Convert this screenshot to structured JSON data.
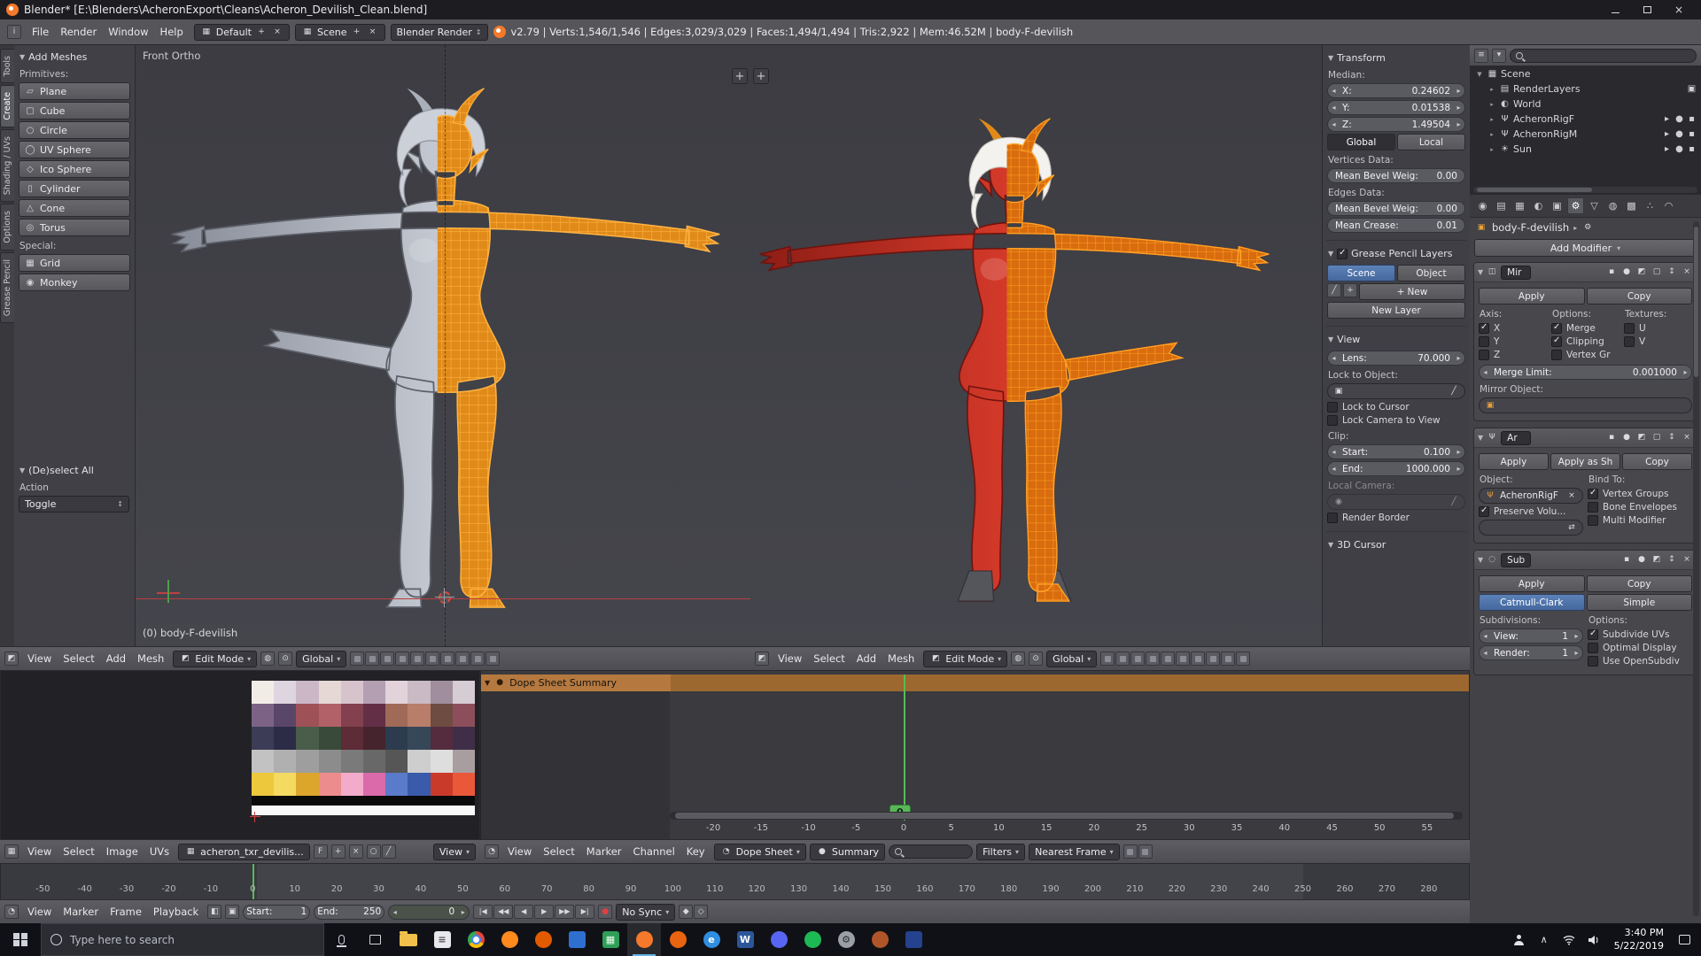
{
  "colors": {
    "accent-blue": "#4a70a8",
    "accent-orange": "#e8821e",
    "selected-channel": "#b5793f",
    "frame-green": "#57bb57",
    "wire-orange": "#ffa428"
  },
  "window": {
    "title": "Blender* [E:\\Blenders\\AcheronExport\\Cleans\\Acheron_Devilish_Clean.blend]"
  },
  "info_bar": {
    "menus": [
      "File",
      "Render",
      "Window",
      "Help"
    ],
    "layout_name": "Default",
    "scene_name": "Scene",
    "engine": "Blender Render",
    "stats": "v2.79 | Verts:1,546/1,546 | Edges:3,029/3,029 | Faces:1,494/1,494 | Tris:2,922 | Mem:46.52M | body-F-devilish"
  },
  "tool_tabs": [
    {
      "label": "Tools",
      "active": false
    },
    {
      "label": "Create",
      "active": true
    },
    {
      "label": "Shading / UVs",
      "active": false
    },
    {
      "label": "Options",
      "active": false
    },
    {
      "label": "Grease Pencil",
      "active": false
    }
  ],
  "tool_shelf": {
    "add_meshes_title": "Add Meshes",
    "primitives_label": "Primitives:",
    "primitives": [
      "Plane",
      "Cube",
      "Circle",
      "UV Sphere",
      "Ico Sphere",
      "Cylinder",
      "Cone",
      "Torus"
    ],
    "special_label": "Special:",
    "special": [
      "Grid",
      "Monkey"
    ],
    "deselect_title": "(De)select All",
    "action_label": "Action",
    "action_value": "Toggle"
  },
  "viewport": {
    "left_label": "Front Ortho",
    "left_object": "(0) body-F-devilish",
    "menus": [
      "View",
      "Select",
      "Add",
      "Mesh"
    ],
    "mode": "Edit Mode",
    "orientation": "Global",
    "header_icons": [
      "manipulator-translate",
      "manipulator-rotate",
      "manipulator-scale",
      "manipulator-axes",
      "snap-magnet",
      "snap-element",
      "snap-target",
      "proportional-editing",
      "opengl-render",
      "opengl-render-anim"
    ]
  },
  "n_panel": {
    "transform_title": "Transform",
    "median_label": "Median:",
    "x_label": "X:",
    "x": "0.24602",
    "y_label": "Y:",
    "y": "0.01538",
    "z_label": "Z:",
    "z": "1.49504",
    "global": "Global",
    "local": "Local",
    "vertices_label": "Vertices Data:",
    "bevel_label": "Mean Bevel Weig:",
    "bevel_value": "0.00",
    "edges_label": "Edges Data:",
    "crease_label": "Mean Crease:",
    "crease_value": "0.01",
    "gp_title": "Grease Pencil Layers",
    "gp_scene": "Scene",
    "gp_object": "Object",
    "gp_new": "New",
    "gp_new_layer": "New Layer",
    "view_title": "View",
    "lens_label": "Lens:",
    "lens": "70.000",
    "lock_object_label": "Lock to Object:",
    "lock_cursor": "Lock to Cursor",
    "lock_camera": "Lock Camera to View",
    "clip_label": "Clip:",
    "clip_start_label": "Start:",
    "clip_start": "0.100",
    "clip_end_label": "End:",
    "clip_end": "1000.000",
    "local_camera_label": "Local Camera:",
    "render_border": "Render Border",
    "cursor_title": "3D Cursor"
  },
  "outliner": {
    "items": [
      {
        "label": "Scene",
        "icon": "scene",
        "depth": 0,
        "right": []
      },
      {
        "label": "RenderLayers",
        "icon": "render-layers",
        "depth": 1,
        "right": [
          "render-layer-toggle"
        ]
      },
      {
        "label": "World",
        "icon": "world",
        "depth": 1,
        "right": []
      },
      {
        "label": "AcheronRigF",
        "icon": "armature",
        "depth": 1,
        "right": [
          "restrict-select",
          "restrict-view",
          "restrict-render"
        ]
      },
      {
        "label": "AcheronRigM",
        "icon": "armature",
        "depth": 1,
        "right": [
          "restrict-select",
          "restrict-view",
          "restrict-render"
        ]
      },
      {
        "label": "Sun",
        "icon": "lamp",
        "depth": 1,
        "right": [
          "restrict-select",
          "restrict-view",
          "restrict-render"
        ]
      }
    ]
  },
  "properties": {
    "tabs": [
      "render",
      "render-layers",
      "scene",
      "world",
      "object",
      "modifiers",
      "object-data",
      "material",
      "texture",
      "particles",
      "physics"
    ],
    "active_tab": "modifiers",
    "context_object": "body-F-devilish",
    "add_modifier_label": "Add Modifier",
    "modifiers": {
      "mirror": {
        "name": "Mir",
        "apply": "Apply",
        "copy": "Copy",
        "axis_label": "Axis:",
        "axis_x": "X",
        "axis_y": "Y",
        "axis_z": "Z",
        "options_label": "Options:",
        "merge": "Merge",
        "clipping": "Clipping",
        "vertex_gr": "Vertex Gr",
        "textures_label": "Textures:",
        "u": "U",
        "v": "V",
        "merge_limit_label": "Merge Limit:",
        "merge_limit": "0.001000",
        "mirror_object_label": "Mirror Object:"
      },
      "armature": {
        "name": "Ar",
        "apply": "Apply",
        "apply_as_shape": "Apply as Sh",
        "copy": "Copy",
        "object_label": "Object:",
        "object": "AcheronRigF",
        "bind_label": "Bind To:",
        "vertex_groups": "Vertex Groups",
        "bone_envelopes": "Bone Envelopes",
        "preserve_volume": "Preserve Volu...",
        "multi_modifier": "Multi Modifier"
      },
      "subsurf": {
        "name": "Sub",
        "apply": "Apply",
        "copy": "Copy",
        "catmull_clark": "Catmull-Clark",
        "simple": "Simple",
        "subdivisions_label": "Subdivisions:",
        "view_label": "View:",
        "view": "1",
        "render_label": "Render:",
        "render": "1",
        "options_label": "Options:",
        "subdivide_uvs": "Subdivide UVs",
        "optimal_display": "Optimal Display",
        "use_opensubdiv": "Use OpenSubdiv"
      }
    }
  },
  "uv_editor": {
    "menus": [
      "View",
      "Select",
      "Image",
      "UVs"
    ],
    "image_name": "acheron_txr_devilis...",
    "fake_user": "F",
    "mode": "View",
    "header_icons": [
      "pin",
      "paint-brush"
    ],
    "palette": [
      [
        "#f2ece6",
        "#ddd5e0",
        "#cbb7c6",
        "#e6d8d4",
        "#d7c3cc",
        "#b49fb2",
        "#e2d2da",
        "#c9bac4",
        "#a08e9e",
        "#d5ccd4"
      ],
      [
        "#7c6386",
        "#5a4668",
        "#9e5258",
        "#b26168",
        "#83404e",
        "#622f46",
        "#a06a58",
        "#b87e6a",
        "#6e4c42",
        "#8c4e5a"
      ],
      [
        "#3c3c56",
        "#2c2c46",
        "#4a5c4a",
        "#3a4a3a",
        "#5e2c36",
        "#46242e",
        "#2c3c4e",
        "#364858",
        "#542c3e",
        "#402e48"
      ],
      [
        "#c2c2c2",
        "#b0b0b0",
        "#9e9e9e",
        "#8c8c8c",
        "#7a7a7a",
        "#686868",
        "#565656",
        "#cecece",
        "#dedede",
        "#a89ea0"
      ],
      [
        "#eec83c",
        "#f4da60",
        "#dca62c",
        "#ec8c8c",
        "#f2abcb",
        "#da6aaa",
        "#5a7aca",
        "#3a5aaa",
        "#ca3a2a",
        "#ea583a"
      ],
      [
        "#0a0a0a"
      ],
      [
        "#f8f8f8"
      ]
    ]
  },
  "dope_sheet": {
    "menus": [
      "View",
      "Select",
      "Marker",
      "Channel",
      "Key"
    ],
    "mode": "Dope Sheet",
    "summary_label": "Summary",
    "filters_label": "Filters",
    "snap_value": "Nearest Frame",
    "channel_label": "Dope Sheet Summary",
    "current_frame": "0",
    "header_icons": [
      "copy-keyframes",
      "paste-keyframes"
    ],
    "ruler": [
      -20,
      -15,
      -10,
      -5,
      0,
      5,
      10,
      15,
      20,
      25,
      30,
      35,
      40,
      45,
      50,
      55
    ]
  },
  "timeline": {
    "menus": [
      "View",
      "Marker",
      "Frame",
      "Playback"
    ],
    "start_label": "Start:",
    "start": "1",
    "end_label": "End:",
    "end": "250",
    "frame": "0",
    "sync": "No Sync",
    "transport": [
      {
        "name": "jump-to-start",
        "glyph": "|◀"
      },
      {
        "name": "prev-keyframe",
        "glyph": "◀◀"
      },
      {
        "name": "play-reverse",
        "glyph": "◀"
      },
      {
        "name": "play",
        "glyph": "▶"
      },
      {
        "name": "next-keyframe",
        "glyph": "▶▶"
      },
      {
        "name": "jump-to-end",
        "glyph": "▶|"
      }
    ],
    "trailing_icons": [
      "autokey",
      "keying-set"
    ],
    "ruler": [
      -50,
      -40,
      -30,
      -20,
      -10,
      0,
      10,
      20,
      30,
      40,
      50,
      60,
      70,
      80,
      90,
      100,
      110,
      120,
      130,
      140,
      150,
      160,
      170,
      180,
      190,
      200,
      210,
      220,
      230,
      240,
      250,
      260,
      270,
      280
    ]
  },
  "taskbar": {
    "search_placeholder": "Type here to search",
    "time": "3:40 PM",
    "date": "5/22/2019",
    "apps": [
      {
        "name": "file-explorer",
        "shape": "folder",
        "bg": "#f0c04a"
      },
      {
        "name": "app-notepad",
        "shape": "square",
        "bg": "#e8e8ec",
        "glyph": "≡",
        "fg": "#555"
      },
      {
        "name": "app-chrome",
        "shape": "circle",
        "bg": "chrome"
      },
      {
        "name": "app-firefox",
        "shape": "circle",
        "bg": "#ff8a1e"
      },
      {
        "name": "app-vlc",
        "shape": "circle",
        "bg": "#e35b00"
      },
      {
        "name": "app-photos",
        "shape": "square",
        "bg": "#2e6fd0"
      },
      {
        "name": "app-sheets",
        "shape": "square",
        "bg": "#2f9e57",
        "glyph": "▦",
        "fg": "#eaffee"
      },
      {
        "name": "app-blender",
        "shape": "circle",
        "bg": "#f5792a",
        "active": true
      },
      {
        "name": "app-firefox-dev",
        "shape": "circle",
        "bg": "#e86410"
      },
      {
        "name": "app-edge",
        "shape": "circle",
        "bg": "#2f8ee0",
        "glyph": "e"
      },
      {
        "name": "app-word",
        "shape": "square",
        "bg": "#2b579a",
        "glyph": "W"
      },
      {
        "name": "app-discord",
        "shape": "circle",
        "bg": "#5865f2"
      },
      {
        "name": "app-spotify",
        "shape": "circle",
        "bg": "#1db954"
      },
      {
        "name": "app-settings",
        "shape": "circle",
        "bg": "#9aa0a6",
        "glyph": "⚙",
        "fg": "#2e2e2e"
      },
      {
        "name": "app-gimp",
        "shape": "circle",
        "bg": "#b0552a"
      },
      {
        "name": "app-movies",
        "shape": "square",
        "bg": "#24428e"
      }
    ]
  },
  "models": {
    "left": {
      "skin": "#c6cad3",
      "skin_dark": "#878c98",
      "outline": "#5c6068",
      "hair": "#ccd0d8",
      "hair_edge": "#8e939e",
      "horn": "#aab0ba",
      "wire_base": "#e08a1a",
      "wire": "#ffb340",
      "tail": "left"
    },
    "right": {
      "skin": "#d63a2a",
      "skin_dark": "#8e1d16",
      "outline": "#6e130e",
      "hair": "#f4f2ee",
      "hair_edge": "#c2beb8",
      "horn": "#e08a1a",
      "hoof": "#55555c",
      "wire_base": "#d96c0e",
      "wire": "#ffa428",
      "tail": "right"
    }
  },
  "glyphs": {
    "panel-open": "▼",
    "panel-closed": "▸",
    "dropdown": "▾",
    "arrow-left": "◂",
    "arrow-right": "▸",
    "check": "✓",
    "close": "×",
    "plus": "+",
    "updown": "↕",
    "swap": "⇄",
    "editor-3d-view": "◩",
    "editor-image": "▦",
    "editor-dope-sheet": "◔",
    "editor-timeline": "◔",
    "editor-outliner": "≡",
    "editor-properties": "▤",
    "editor-info": "i",
    "edit-mode": "◩",
    "viewport-shading": "◍",
    "pivot-point": "⊙",
    "screen-layout": "▦",
    "scene-datablock": "▦",
    "image-datablock": "▦",
    "fake-user": "F",
    "pin": "○",
    "paint-brush": "╱",
    "clock": "◔",
    "summary-dot": "●",
    "record": "●",
    "autokey": "◆",
    "keying-set": "◇",
    "preview-range": "◧",
    "time-lock": "▣",
    "object-cube": "▣",
    "wrench": "⚙",
    "camera-data": "◉",
    "eyedropper": "╱",
    "grease-pencil": "╱",
    "mod-mirror": "◫",
    "mod-armature": "Ψ",
    "mod-subsurf": "◌",
    "toggle-render": "▪",
    "toggle-eye": "●",
    "toggle-edit": "◩",
    "toggle-cage": "▢",
    "scene": "▦",
    "render-layers": "▤",
    "world": "◐",
    "armature": "Ψ",
    "lamp": "☀",
    "render-layer-toggle": "▣",
    "restrict-select": "▸",
    "restrict-view": "●",
    "restrict-render": "▪",
    "tab-render": "◉",
    "tab-render-layers": "▤",
    "tab-scene": "▦",
    "tab-world": "◐",
    "tab-object": "▣",
    "tab-modifiers": "⚙",
    "tab-object-data": "▽",
    "tab-material": "◍",
    "tab-texture": "▩",
    "tab-particles": "∴",
    "tab-physics": "◠",
    "prim-Plane": "▱",
    "prim-Cube": "▢",
    "prim-Circle": "○",
    "prim-UV Sphere": "◯",
    "prim-Ico Sphere": "◇",
    "prim-Cylinder": "▯",
    "prim-Cone": "△",
    "prim-Torus": "◎",
    "prim-Grid": "▦",
    "prim-Monkey": "◉"
  }
}
